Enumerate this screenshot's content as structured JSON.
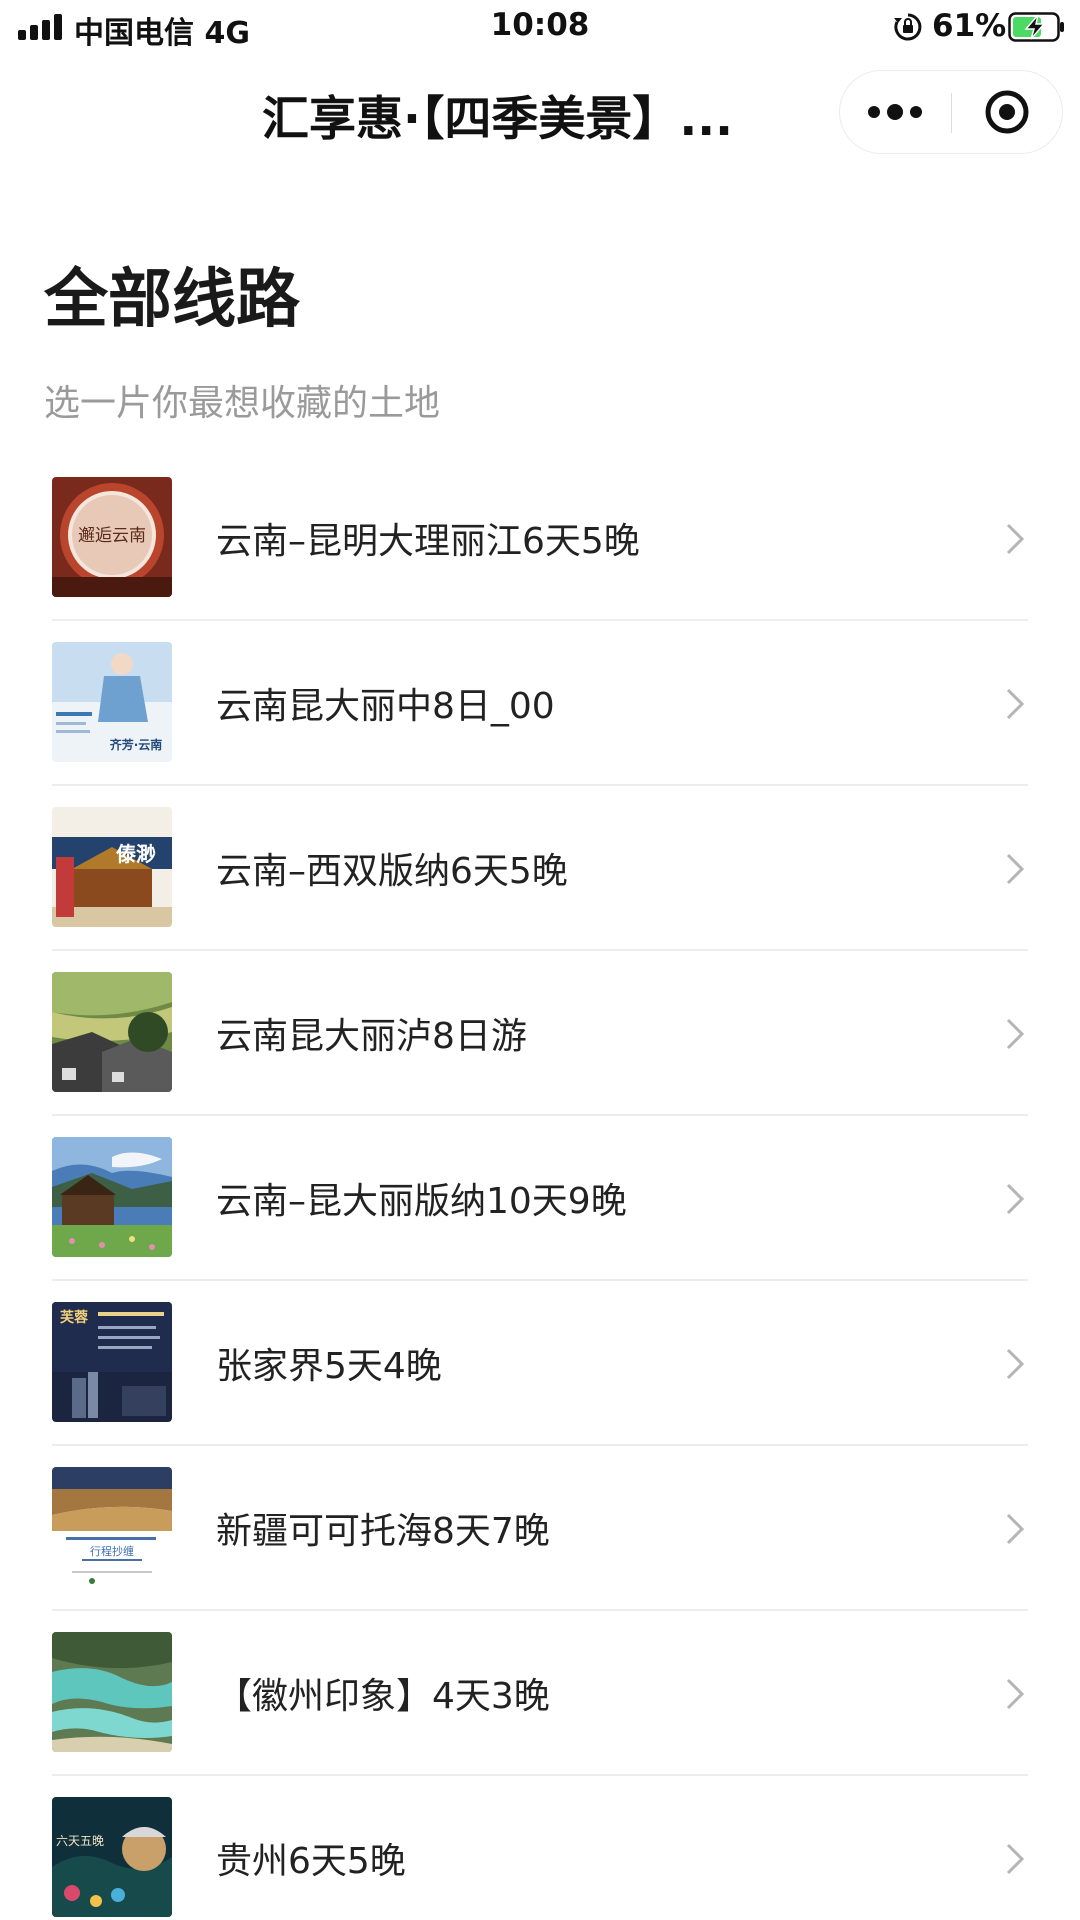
{
  "status_bar": {
    "carrier": "中国电信  4G",
    "time": "10:08",
    "battery_percent": "61%"
  },
  "nav": {
    "title": "汇享惠·【四季美景】..."
  },
  "page": {
    "title": "全部线路",
    "subtitle": "选一片你最想收藏的土地"
  },
  "routes": [
    {
      "label": "云南–昆明大理丽江6天5晚",
      "thumb_text": "邂逅云南"
    },
    {
      "label": "云南昆大丽中8日_00",
      "thumb_text": "齐芳·云南"
    },
    {
      "label": "云南–西双版纳6天5晚",
      "thumb_text": "傣渺"
    },
    {
      "label": "云南昆大丽泸8日游"
    },
    {
      "label": "云南–昆大丽版纳10天9晚"
    },
    {
      "label": "张家界5天4晚",
      "thumb_text": "芙蓉"
    },
    {
      "label": "新疆可可托海8天7晚",
      "thumb_text": "行程抄缠"
    },
    {
      "label": "【徽州印象】4天3晚"
    },
    {
      "label": "贵州6天5晚",
      "thumb_text": "六天五晚"
    }
  ]
}
